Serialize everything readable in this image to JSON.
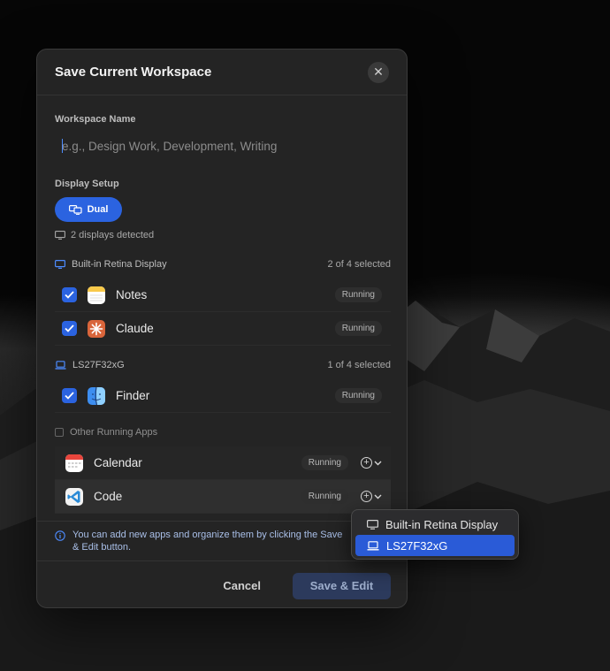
{
  "dialog": {
    "title": "Save Current Workspace",
    "close_icon": "close-icon"
  },
  "workspace_name": {
    "label": "Workspace Name",
    "value": "",
    "placeholder": "e.g., Design Work, Development, Writing"
  },
  "display_setup": {
    "label": "Display Setup",
    "mode_button": "Dual",
    "detected": "2 displays detected"
  },
  "displays": [
    {
      "name": "Built-in Retina Display",
      "selected_count": "2 of 4 selected",
      "apps": [
        {
          "name": "Notes",
          "status": "Running",
          "checked": true,
          "icon": "notes-icon"
        },
        {
          "name": "Claude",
          "status": "Running",
          "checked": true,
          "icon": "claude-icon"
        }
      ]
    },
    {
      "name": "LS27F32xG",
      "selected_count": "1 of 4 selected",
      "apps": [
        {
          "name": "Finder",
          "status": "Running",
          "checked": true,
          "icon": "finder-icon"
        }
      ]
    }
  ],
  "other_apps": {
    "label": "Other Running Apps",
    "apps": [
      {
        "name": "Calendar",
        "status": "Running",
        "icon": "calendar-icon"
      },
      {
        "name": "Code",
        "status": "Running",
        "icon": "vscode-icon"
      }
    ]
  },
  "info_text": "You can add new apps and organize them by clicking the Save & Edit button.",
  "footer": {
    "cancel": "Cancel",
    "save": "Save & Edit"
  },
  "display_menu": {
    "items": [
      {
        "label": "Built-in Retina Display",
        "selected": false
      },
      {
        "label": "LS27F32xG",
        "selected": true
      }
    ]
  },
  "colors": {
    "accent": "#2b63e0",
    "background": "#242424"
  }
}
